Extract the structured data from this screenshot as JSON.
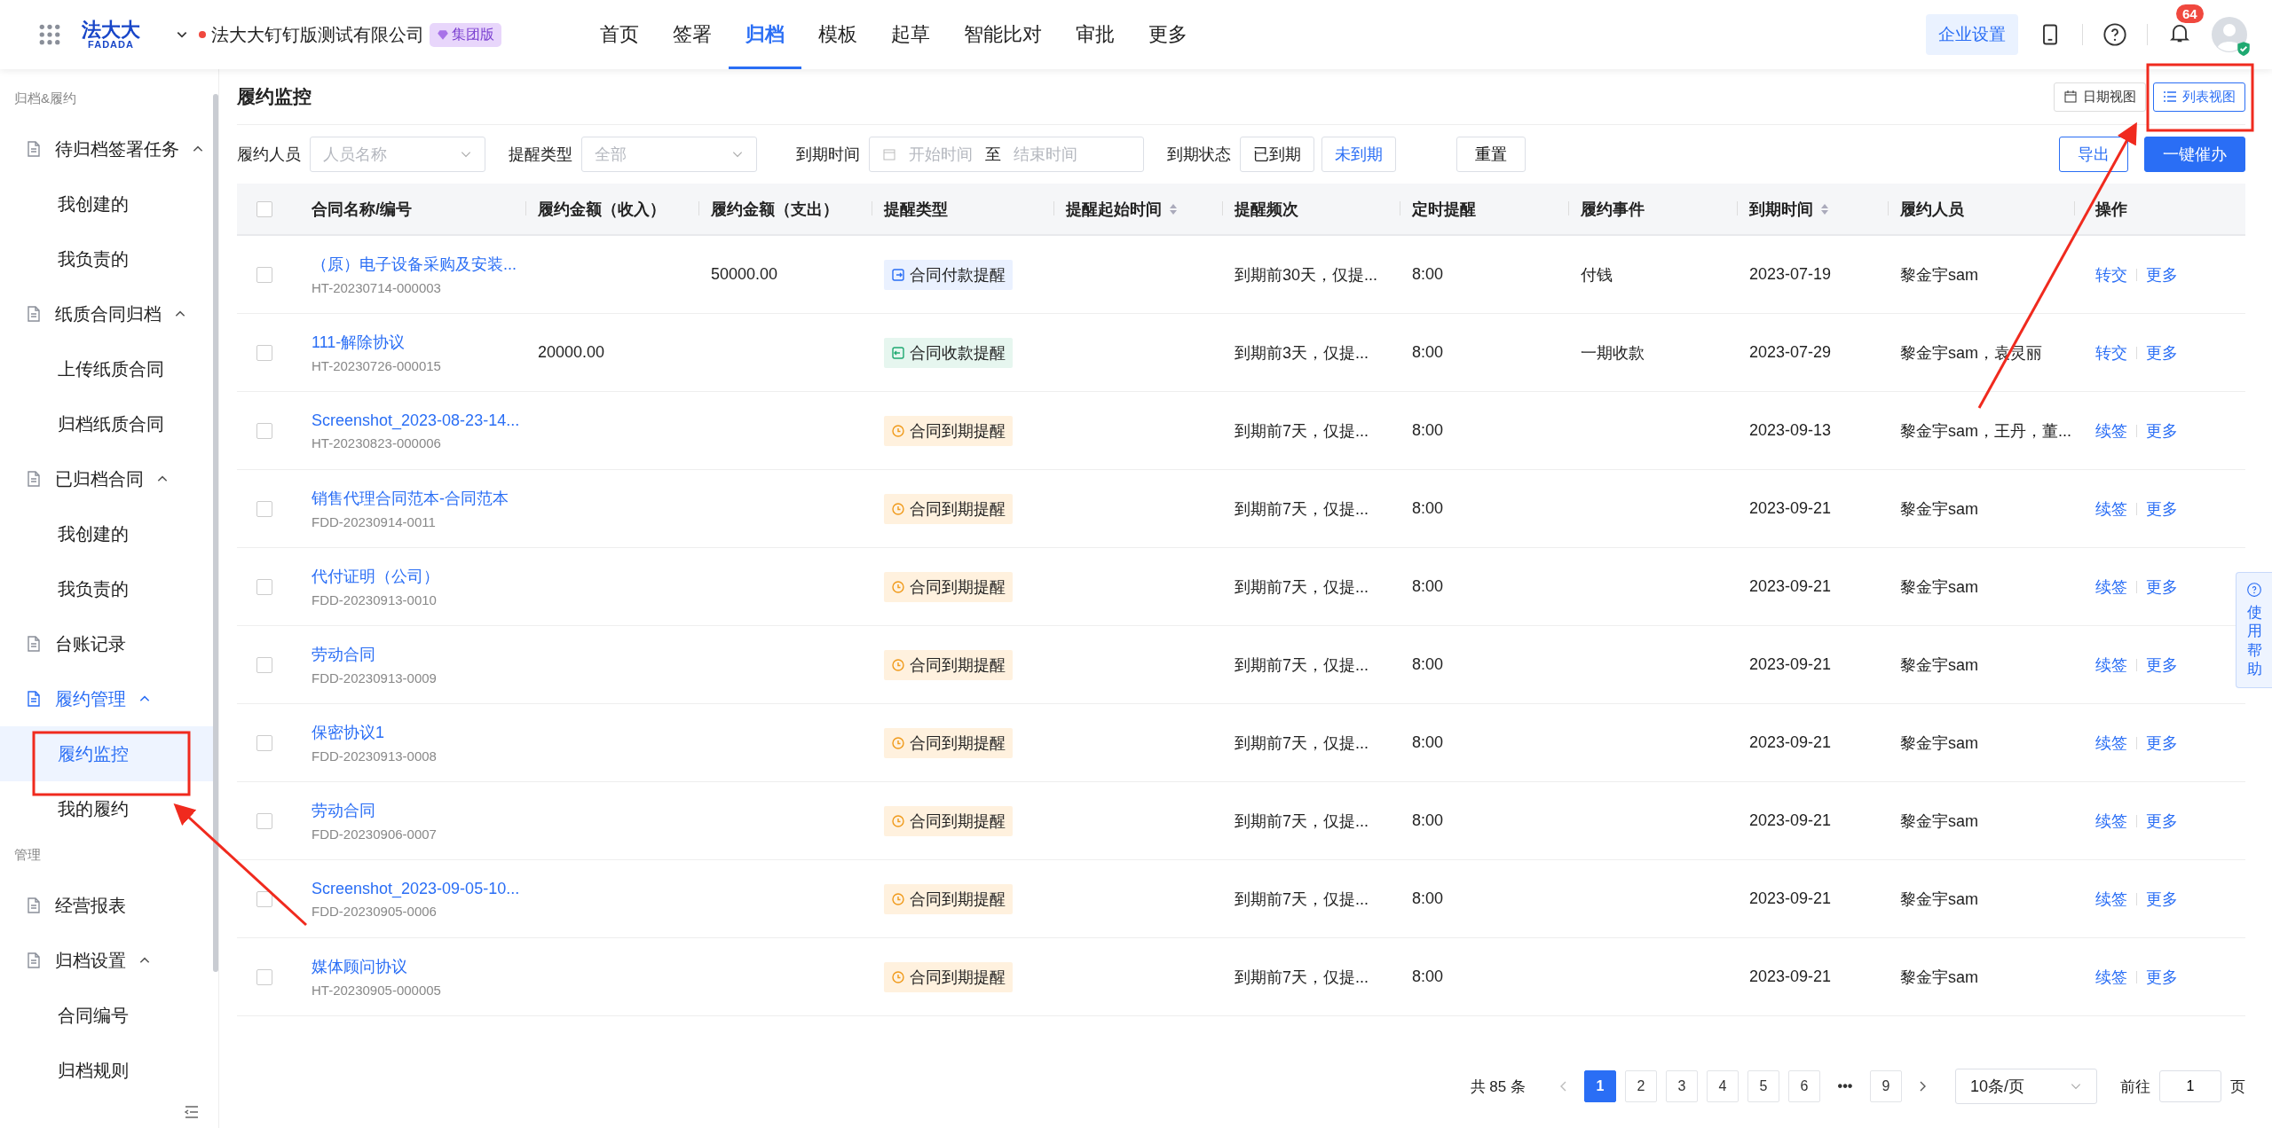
{
  "header": {
    "logo": {
      "cn": "法大大",
      "en": "FADADA"
    },
    "company": "法大大钉钉版测试有限公司",
    "edition_badge": "集团版",
    "nav": [
      {
        "label": "首页",
        "selected": false
      },
      {
        "label": "签署",
        "selected": false
      },
      {
        "label": "归档",
        "selected": true
      },
      {
        "label": "模板",
        "selected": false
      },
      {
        "label": "起草",
        "selected": false
      },
      {
        "label": "智能比对",
        "selected": false
      },
      {
        "label": "审批",
        "selected": false
      },
      {
        "label": "更多",
        "selected": false
      }
    ],
    "settings_button": "企业设置",
    "notification_count": "64"
  },
  "sidebar": {
    "sections": [
      {
        "title": "归档&履约",
        "items": [
          {
            "label": "待归档签署任务",
            "expanded": true,
            "children": [
              {
                "label": "我创建的",
                "selected": false
              },
              {
                "label": "我负责的",
                "selected": false
              }
            ]
          },
          {
            "label": "纸质合同归档",
            "expanded": true,
            "children": [
              {
                "label": "上传纸质合同",
                "selected": false
              },
              {
                "label": "归档纸质合同",
                "selected": false
              }
            ]
          },
          {
            "label": "已归档合同",
            "expanded": true,
            "children": [
              {
                "label": "我创建的",
                "selected": false
              },
              {
                "label": "我负责的",
                "selected": false
              }
            ]
          },
          {
            "label": "台账记录"
          },
          {
            "label": "履约管理",
            "expanded": true,
            "children": [
              {
                "label": "履约监控",
                "selected": true
              },
              {
                "label": "我的履约",
                "selected": false
              }
            ]
          }
        ]
      },
      {
        "title": "管理",
        "items": [
          {
            "label": "经营报表"
          },
          {
            "label": "归档设置",
            "expanded": true,
            "children": [
              {
                "label": "合同编号",
                "selected": false
              },
              {
                "label": "归档规则",
                "selected": false
              }
            ]
          }
        ]
      }
    ]
  },
  "page": {
    "title": "履约监控",
    "views": [
      {
        "label": "日期视图",
        "selected": false
      },
      {
        "label": "列表视图",
        "selected": true
      }
    ]
  },
  "filters": {
    "person": {
      "label": "履约人员",
      "placeholder": "人员名称"
    },
    "type": {
      "label": "提醒类型",
      "value": "全部"
    },
    "due_time": {
      "label": "到期时间",
      "start_placeholder": "开始时间",
      "separator": "至",
      "end_placeholder": "结束时间"
    },
    "due_status": {
      "label": "到期状态",
      "options": [
        {
          "label": "已到期",
          "selected": false
        },
        {
          "label": "未到期",
          "selected": true
        }
      ]
    },
    "reset": "重置",
    "export": "导出",
    "remind_all": "一键催办"
  },
  "table": {
    "select_all_checked": false,
    "columns": [
      {
        "label": "合同名称/编号",
        "sortable": false
      },
      {
        "label": "履约金额（收入）",
        "sortable": false
      },
      {
        "label": "履约金额（支出）",
        "sortable": false
      },
      {
        "label": "提醒类型",
        "sortable": false
      },
      {
        "label": "提醒起始时间",
        "sortable": true
      },
      {
        "label": "提醒频次",
        "sortable": false
      },
      {
        "label": "定时提醒",
        "sortable": false
      },
      {
        "label": "履约事件",
        "sortable": false
      },
      {
        "label": "到期时间",
        "sortable": true
      },
      {
        "label": "履约人员",
        "sortable": false
      },
      {
        "label": "操作",
        "sortable": false
      }
    ],
    "rows": [
      {
        "name": "（原）电子设备采购及安装...",
        "code": "HT-20230714-000003",
        "expense": "50000.00",
        "type": {
          "kind": "payment",
          "label": "合同付款提醒"
        },
        "frequency": "到期前30天，仅提...",
        "timing": "8:00",
        "event": "付钱",
        "due": "2023-07-19",
        "person": "黎金宇sam",
        "actions": [
          "转交",
          "更多"
        ],
        "checked": false
      },
      {
        "name": "111-解除协议",
        "code": "HT-20230726-000015",
        "income": "20000.00",
        "type": {
          "kind": "receipt",
          "label": "合同收款提醒"
        },
        "frequency": "到期前3天，仅提...",
        "timing": "8:00",
        "event": "一期收款",
        "due": "2023-07-29",
        "person": "黎金宇sam，袁灵丽",
        "actions": [
          "转交",
          "更多"
        ],
        "checked": false
      },
      {
        "name": "Screenshot_2023-08-23-14...",
        "code": "HT-20230823-000006",
        "type": {
          "kind": "expiry",
          "label": "合同到期提醒"
        },
        "frequency": "到期前7天，仅提...",
        "timing": "8:00",
        "due": "2023-09-13",
        "person": "黎金宇sam，王丹，董...",
        "actions": [
          "续签",
          "更多"
        ],
        "checked": false
      },
      {
        "name": "销售代理合同范本-合同范本",
        "code": "FDD-20230914-0011",
        "type": {
          "kind": "expiry",
          "label": "合同到期提醒"
        },
        "frequency": "到期前7天，仅提...",
        "timing": "8:00",
        "due": "2023-09-21",
        "person": "黎金宇sam",
        "actions": [
          "续签",
          "更多"
        ],
        "checked": false
      },
      {
        "name": "代付证明（公司）",
        "code": "FDD-20230913-0010",
        "type": {
          "kind": "expiry",
          "label": "合同到期提醒"
        },
        "frequency": "到期前7天，仅提...",
        "timing": "8:00",
        "due": "2023-09-21",
        "person": "黎金宇sam",
        "actions": [
          "续签",
          "更多"
        ],
        "checked": false
      },
      {
        "name": "劳动合同",
        "code": "FDD-20230913-0009",
        "type": {
          "kind": "expiry",
          "label": "合同到期提醒"
        },
        "frequency": "到期前7天，仅提...",
        "timing": "8:00",
        "due": "2023-09-21",
        "person": "黎金宇sam",
        "actions": [
          "续签",
          "更多"
        ],
        "checked": false
      },
      {
        "name": "保密协议1",
        "code": "FDD-20230913-0008",
        "type": {
          "kind": "expiry",
          "label": "合同到期提醒"
        },
        "frequency": "到期前7天，仅提...",
        "timing": "8:00",
        "due": "2023-09-21",
        "person": "黎金宇sam",
        "actions": [
          "续签",
          "更多"
        ],
        "checked": false
      },
      {
        "name": "劳动合同",
        "code": "FDD-20230906-0007",
        "type": {
          "kind": "expiry",
          "label": "合同到期提醒"
        },
        "frequency": "到期前7天，仅提...",
        "timing": "8:00",
        "due": "2023-09-21",
        "person": "黎金宇sam",
        "actions": [
          "续签",
          "更多"
        ],
        "checked": false
      },
      {
        "name": "Screenshot_2023-09-05-10...",
        "code": "FDD-20230905-0006",
        "type": {
          "kind": "expiry",
          "label": "合同到期提醒"
        },
        "frequency": "到期前7天，仅提...",
        "timing": "8:00",
        "due": "2023-09-21",
        "person": "黎金宇sam",
        "actions": [
          "续签",
          "更多"
        ],
        "checked": false
      },
      {
        "name": "媒体顾问协议",
        "code": "HT-20230905-000005",
        "type": {
          "kind": "expiry",
          "label": "合同到期提醒"
        },
        "frequency": "到期前7天，仅提...",
        "timing": "8:00",
        "due": "2023-09-21",
        "person": "黎金宇sam",
        "actions": [
          "续签",
          "更多"
        ],
        "checked": false
      }
    ]
  },
  "pagination": {
    "total": "共 85 条",
    "pages": [
      {
        "label": "1",
        "selected": true
      },
      {
        "label": "2",
        "selected": false
      },
      {
        "label": "3",
        "selected": false
      },
      {
        "label": "4",
        "selected": false
      },
      {
        "label": "5",
        "selected": false
      },
      {
        "label": "6",
        "selected": false
      },
      {
        "label": "•••",
        "selected": false
      },
      {
        "label": "9",
        "selected": false
      }
    ],
    "page_size": "10条/页",
    "goto_label": "前往",
    "goto_value": "1",
    "goto_suffix": "页"
  },
  "help_tab": "使用帮助"
}
